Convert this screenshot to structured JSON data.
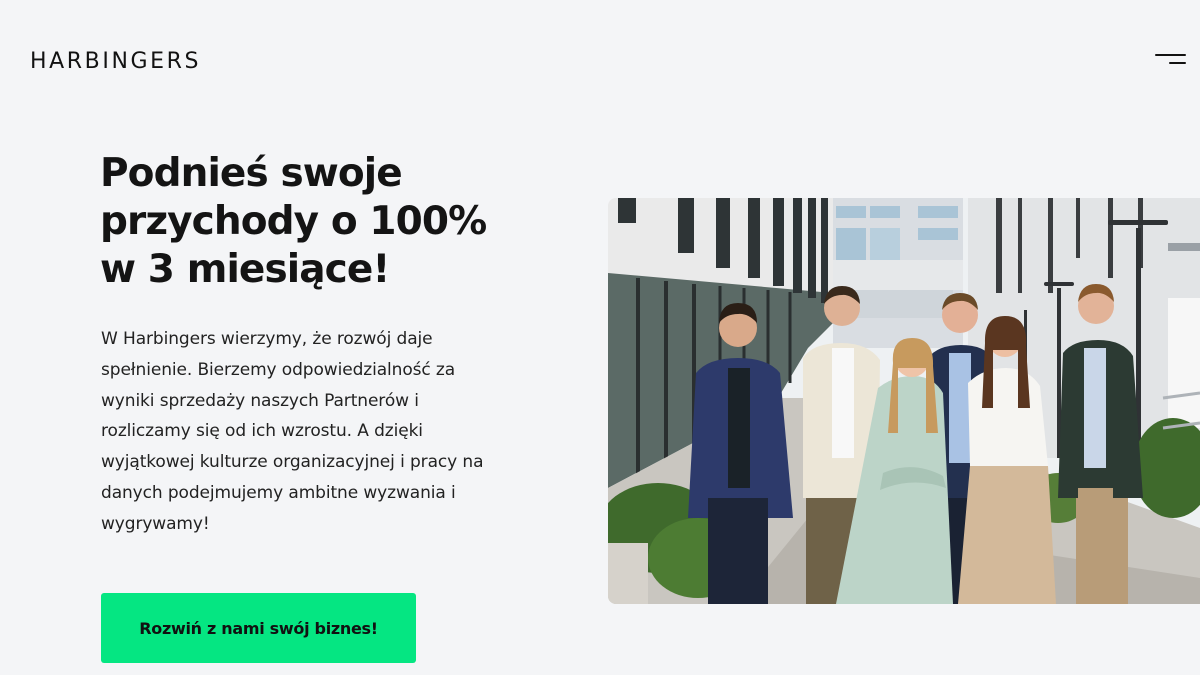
{
  "header": {
    "logo": "HARBINGERS",
    "menu_icon": "hamburger-menu-icon"
  },
  "hero": {
    "headline_lines": [
      "Podnieś swoje",
      "przychody o 100%",
      "w 3 miesiące!"
    ],
    "intro_lines": [
      "W Harbingers wierzymy, że rozwój daje",
      "spełnienie. Bierzemy odpowiedzialność za",
      "wyniki sprzedaży naszych Partnerów i",
      "rozliczamy się od ich wzrostu. A dzięki",
      "wyjątkowej kulturze organizacyjnej i pracy na",
      "danych podejmujemy ambitne wyzwania i",
      "wygrywamy!"
    ],
    "cta_label": "Rozwiń z nami swój biznes!"
  },
  "colors": {
    "background": "#f4f5f7",
    "text": "#121212",
    "accent": "#05e682"
  }
}
